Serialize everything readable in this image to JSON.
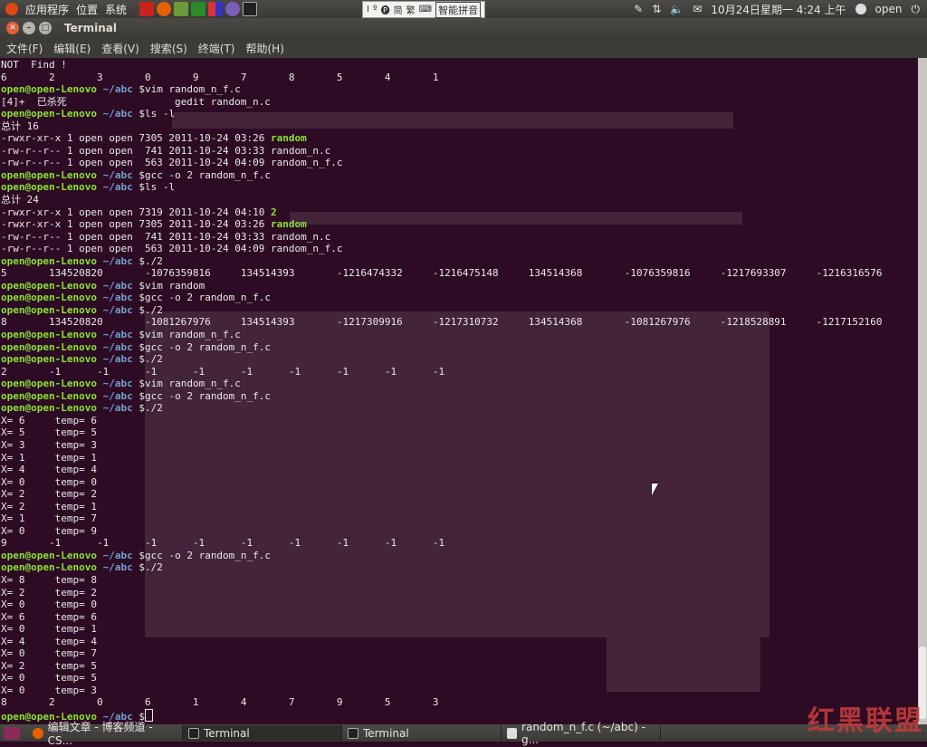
{
  "top_panel": {
    "menus": [
      "应用程序",
      "位置",
      "系统"
    ],
    "ime": {
      "glyphs": [
        "Ⅰ",
        "º",
        "🅟",
        "简",
        "繁",
        "⌨"
      ],
      "label": "智能拼音"
    },
    "datetime": "10月24日星期一  4:24 上午",
    "user": "open"
  },
  "window": {
    "title": "Terminal",
    "menu": [
      "文件(F)",
      "编辑(E)",
      "查看(V)",
      "搜索(S)",
      "终端(T)",
      "帮助(H)"
    ]
  },
  "terminal": {
    "prompt_user": "open@open-Lenovo",
    "prompt_path": "~/abc",
    "lines": [
      {
        "t": "text",
        "v": "NOT  Find !"
      },
      {
        "t": "text",
        "v": "6       2       3       0       9       7       8       5       4       1"
      },
      {
        "t": "prompt",
        "v": "$vim random_n_f.c"
      },
      {
        "t": "text",
        "v": "[4]+  已杀死                  gedit random_n.c"
      },
      {
        "t": "prompt",
        "v": "$ls -l"
      },
      {
        "t": "text",
        "v": "总计 16"
      },
      {
        "t": "ls",
        "v": "-rwxr-xr-x 1 open open 7305 2011-10-24 03:26 ",
        "exe": "random"
      },
      {
        "t": "text",
        "v": "-rw-r--r-- 1 open open  741 2011-10-24 03:33 random_n.c"
      },
      {
        "t": "text",
        "v": "-rw-r--r-- 1 open open  563 2011-10-24 04:09 random_n_f.c"
      },
      {
        "t": "prompt",
        "v": "$gcc -o 2 random_n_f.c"
      },
      {
        "t": "prompt",
        "v": "$ls -l"
      },
      {
        "t": "text",
        "v": "总计 24"
      },
      {
        "t": "ls",
        "v": "-rwxr-xr-x 1 open open 7319 2011-10-24 04:10 ",
        "exe": "2"
      },
      {
        "t": "ls",
        "v": "-rwxr-xr-x 1 open open 7305 2011-10-24 03:26 ",
        "exe": "random"
      },
      {
        "t": "text",
        "v": "-rw-r--r-- 1 open open  741 2011-10-24 03:33 random_n.c"
      },
      {
        "t": "text",
        "v": "-rw-r--r-- 1 open open  563 2011-10-24 04:09 random_n_f.c"
      },
      {
        "t": "prompt",
        "v": "$./2"
      },
      {
        "t": "text",
        "v": "5       134520820       -1076359816     134514393       -1216474332     -1216475148     134514368       -1076359816     -1217693307     -1216316576"
      },
      {
        "t": "prompt",
        "v": "$vim random"
      },
      {
        "t": "prompt",
        "v": "$gcc -o 2 random_n_f.c"
      },
      {
        "t": "prompt",
        "v": "$./2"
      },
      {
        "t": "text",
        "v": "8       134520820       -1081267976     134514393       -1217309916     -1217310732     134514368       -1081267976     -1218528891     -1217152160"
      },
      {
        "t": "prompt",
        "v": "$vim random_n_f.c"
      },
      {
        "t": "prompt",
        "v": "$gcc -o 2 random_n_f.c"
      },
      {
        "t": "prompt",
        "v": "$./2"
      },
      {
        "t": "text",
        "v": "2       -1      -1      -1      -1      -1      -1      -1      -1      -1"
      },
      {
        "t": "prompt",
        "v": "$vim random_n_f.c"
      },
      {
        "t": "prompt",
        "v": "$gcc -o 2 random_n_f.c"
      },
      {
        "t": "prompt",
        "v": "$./2"
      },
      {
        "t": "text",
        "v": "X= 6     temp= 6"
      },
      {
        "t": "text",
        "v": "X= 5     temp= 5"
      },
      {
        "t": "text",
        "v": "X= 3     temp= 3"
      },
      {
        "t": "text",
        "v": "X= 1     temp= 1"
      },
      {
        "t": "text",
        "v": "X= 4     temp= 4"
      },
      {
        "t": "text",
        "v": "X= 0     temp= 0"
      },
      {
        "t": "text",
        "v": "X= 2     temp= 2"
      },
      {
        "t": "text",
        "v": "X= 2     temp= 1"
      },
      {
        "t": "text",
        "v": "X= 1     temp= 7"
      },
      {
        "t": "text",
        "v": "X= 0     temp= 9"
      },
      {
        "t": "text",
        "v": "9       -1      -1      -1      -1      -1      -1      -1      -1      -1"
      },
      {
        "t": "prompt",
        "v": "$gcc -o 2 random_n_f.c"
      },
      {
        "t": "prompt",
        "v": "$./2"
      },
      {
        "t": "text",
        "v": "X= 8     temp= 8"
      },
      {
        "t": "text",
        "v": "X= 2     temp= 2"
      },
      {
        "t": "text",
        "v": "X= 0     temp= 0"
      },
      {
        "t": "text",
        "v": "X= 6     temp= 6"
      },
      {
        "t": "text",
        "v": "X= 0     temp= 1"
      },
      {
        "t": "text",
        "v": "X= 4     temp= 4"
      },
      {
        "t": "text",
        "v": "X= 0     temp= 7"
      },
      {
        "t": "text",
        "v": "X= 2     temp= 5"
      },
      {
        "t": "text",
        "v": "X= 0     temp= 5"
      },
      {
        "t": "text",
        "v": "X= 0     temp= 3"
      },
      {
        "t": "text",
        "v": "8       2       0       6       1       4       7       9       5       3"
      },
      {
        "t": "prompt_cursor",
        "v": "$"
      }
    ]
  },
  "taskbar": {
    "tasks": [
      {
        "label": "编辑文章 - 博客频道 - CS...",
        "icon": "firefox-icon"
      },
      {
        "label": "Terminal",
        "icon": "terminal-icon"
      },
      {
        "label": "Terminal",
        "icon": "terminal-icon"
      },
      {
        "label": "random_n_f.c (~/abc) - g...",
        "icon": "text-editor-icon"
      }
    ]
  },
  "colors": {
    "terminal_bg": "#2d0b24",
    "prompt_green": "#8ae234",
    "path_blue": "#729fcf"
  }
}
